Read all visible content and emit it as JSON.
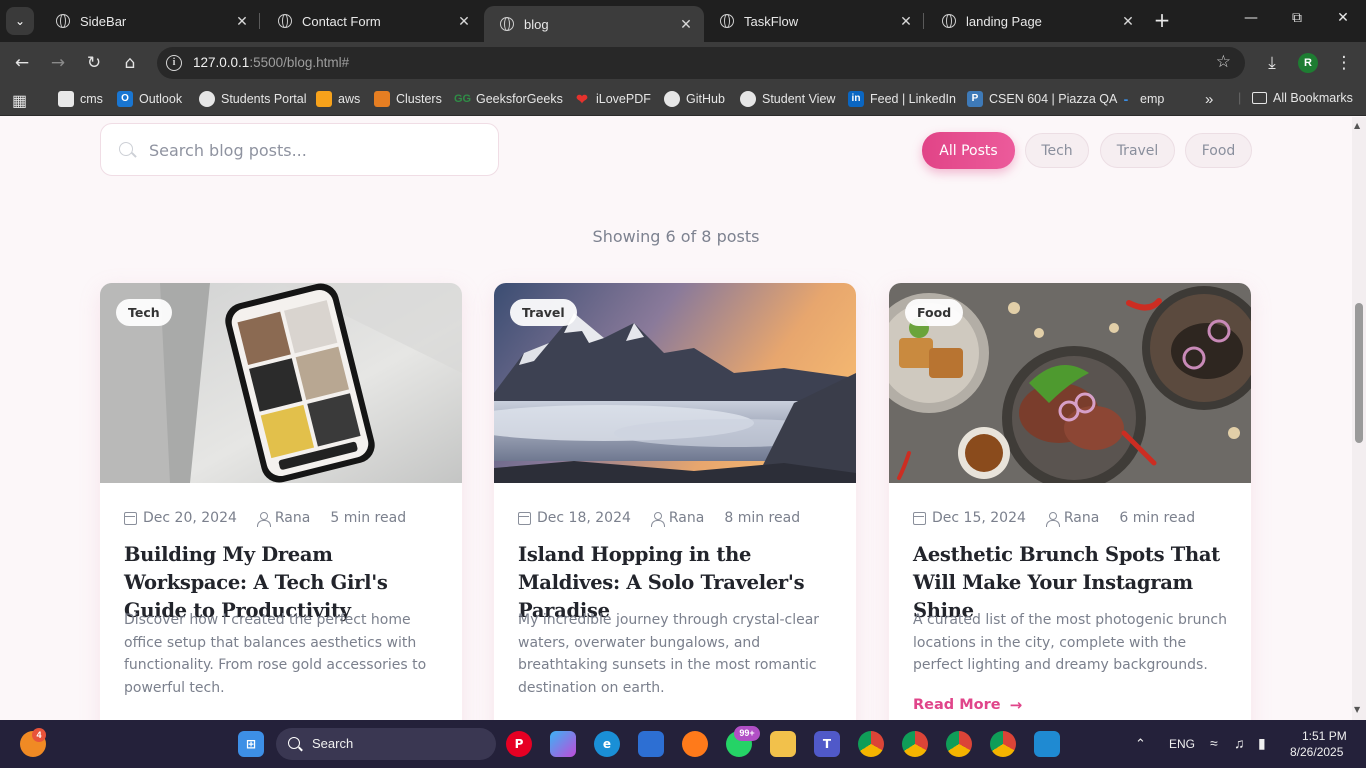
{
  "browser": {
    "tabs": [
      {
        "title": "SideBar",
        "active": false
      },
      {
        "title": "Contact Form",
        "active": false
      },
      {
        "title": "blog",
        "active": true
      },
      {
        "title": "TaskFlow",
        "active": false
      },
      {
        "title": "landing Page",
        "active": false
      }
    ],
    "url_host": "127.0.0.1",
    "url_path": ":5500/blog.html#",
    "profile_initial": "R",
    "bookmarks": [
      {
        "label": "cms",
        "icon": "file-icon"
      },
      {
        "label": "Outlook",
        "icon": "outlook-icon"
      },
      {
        "label": "Students Portal",
        "icon": "globe-icon"
      },
      {
        "label": "aws",
        "icon": "aws-icon"
      },
      {
        "label": "Clusters",
        "icon": "clusters-icon"
      },
      {
        "label": "GeeksforGeeks",
        "icon": "gfg-icon"
      },
      {
        "label": "iLovePDF",
        "icon": "ilovepdf-icon"
      },
      {
        "label": "GitHub",
        "icon": "github-icon"
      },
      {
        "label": "Student View",
        "icon": "globe-icon"
      },
      {
        "label": "Feed | LinkedIn",
        "icon": "linkedin-icon"
      },
      {
        "label": "CSEN 604 | Piazza QA",
        "icon": "piazza-icon"
      },
      {
        "label": "emp",
        "icon": "dash-icon"
      }
    ],
    "all_bookmarks_label": "All Bookmarks"
  },
  "page": {
    "search_placeholder": "Search blog posts...",
    "filters": [
      {
        "label": "All Posts",
        "active": true
      },
      {
        "label": "Tech",
        "active": false
      },
      {
        "label": "Travel",
        "active": false
      },
      {
        "label": "Food",
        "active": false
      }
    ],
    "showing_text": "Showing 6 of 8 posts",
    "posts": [
      {
        "category": "Tech",
        "date": "Dec 20, 2024",
        "author": "Rana",
        "read_time": "5 min read",
        "title": "Building My Dream Workspace: A Tech Girl's Guide to Productivity",
        "excerpt": "Discover how I created the perfect home office setup that balances aesthetics with functionality. From rose gold accessories to powerful tech."
      },
      {
        "category": "Travel",
        "date": "Dec 18, 2024",
        "author": "Rana",
        "read_time": "8 min read",
        "title": "Island Hopping in the Maldives: A Solo Traveler's Paradise",
        "excerpt": "My incredible journey through crystal-clear waters, overwater bungalows, and breathtaking sunsets in the most romantic destination on earth."
      },
      {
        "category": "Food",
        "date": "Dec 15, 2024",
        "author": "Rana",
        "read_time": "6 min read",
        "title": "Aesthetic Brunch Spots That Will Make Your Instagram Shine",
        "excerpt": "A curated list of the most photogenic brunch locations in the city, complete with the perfect lighting and dreamy backgrounds.",
        "read_more": "Read More"
      }
    ],
    "accent_color": "#e14487"
  },
  "taskbar": {
    "search_label": "Search",
    "notification_count": "4",
    "whatsapp_badge": "99+",
    "language": "ENG",
    "time": "1:51 PM",
    "date": "8/26/2025"
  }
}
